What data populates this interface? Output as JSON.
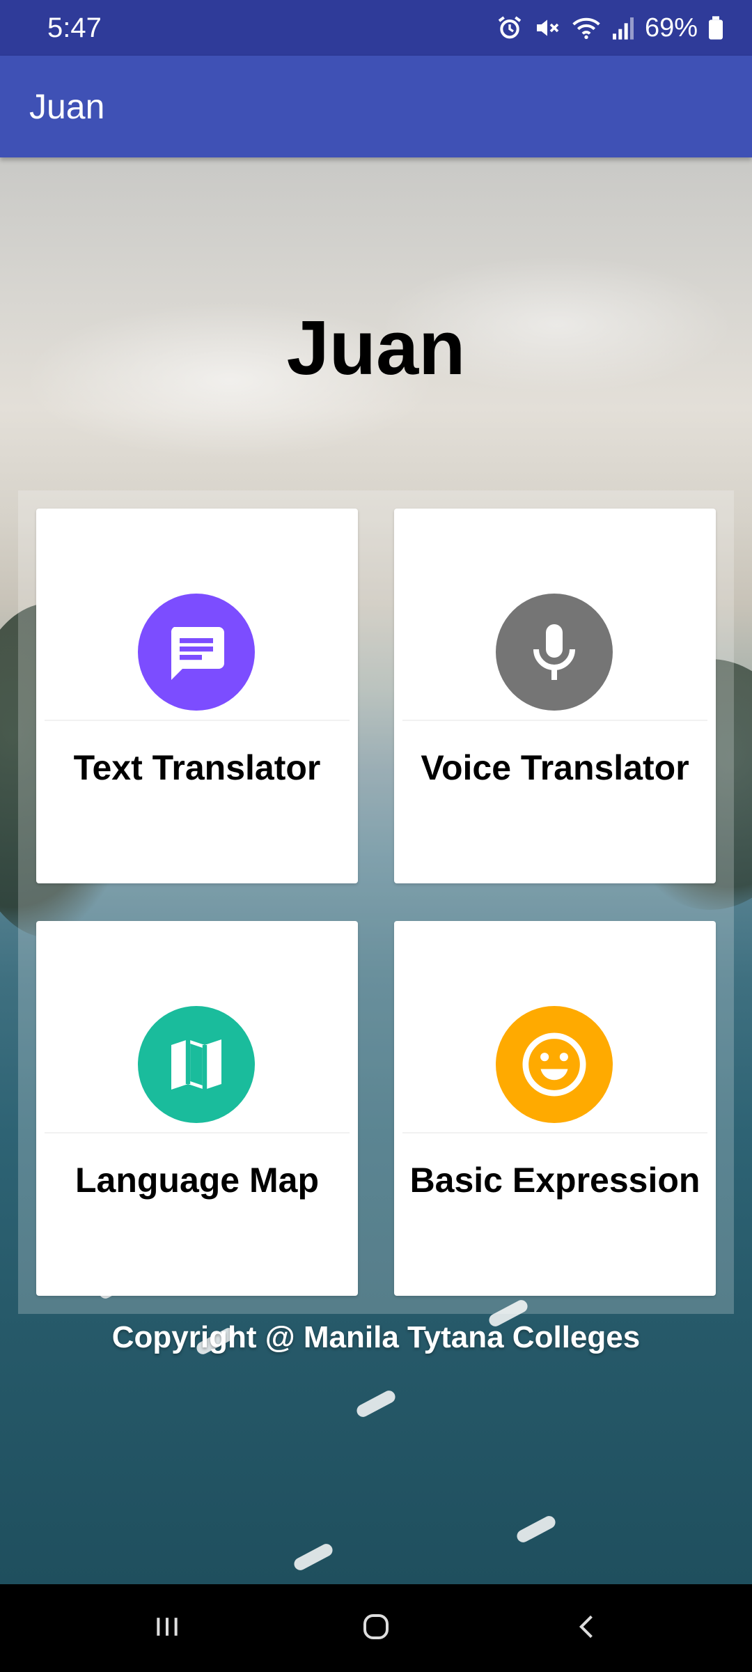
{
  "status_bar": {
    "time": "5:47",
    "battery": "69%",
    "icons": [
      "alarm-icon",
      "mute-icon",
      "wifi-icon",
      "signal-icon",
      "battery-icon"
    ]
  },
  "app_bar": {
    "title": "Juan"
  },
  "hero": {
    "title": "Juan"
  },
  "menu": {
    "items": [
      {
        "label": "Text Translator",
        "icon": "chat-message-icon",
        "color": "#7c4dff"
      },
      {
        "label": "Voice Translator",
        "icon": "microphone-icon",
        "color": "#757575"
      },
      {
        "label": "Language Map",
        "icon": "map-icon",
        "color": "#1abc9c"
      },
      {
        "label": "Basic Expression",
        "icon": "smiley-face-icon",
        "color": "#ffaa00"
      }
    ]
  },
  "footer": {
    "copyright": "Copyright @ Manila Tytana Colleges"
  },
  "nav_bar": {
    "buttons": [
      "recent-apps-icon",
      "home-icon",
      "back-icon"
    ]
  },
  "colors": {
    "status_bar": "#2f3b99",
    "app_bar": "#3f51b5",
    "nav_bar": "#000000"
  }
}
